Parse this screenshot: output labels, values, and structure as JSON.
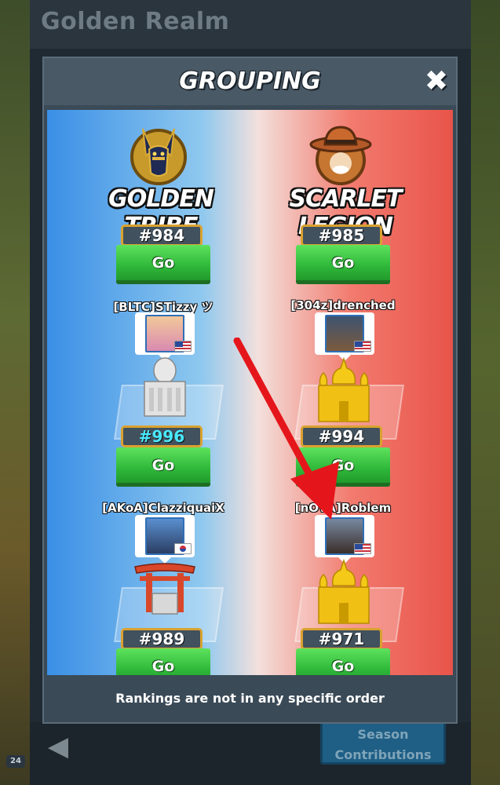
{
  "background": {
    "realm_title": "Golden Realm",
    "back_icon": "back-arrow-icon",
    "level_badge": "24",
    "season_button": {
      "line1": "Season",
      "line2": "Contributions"
    }
  },
  "modal": {
    "title": "GROUPING",
    "close_icon": "close-icon",
    "footer_note": "Rankings are not in any specific order"
  },
  "teams": [
    {
      "name": "GOLDEN TRIBE",
      "emblem": "anubis-emblem-icon",
      "color": "#3a8fe6"
    },
    {
      "name": "SCARLET LEGION",
      "emblem": "cowboy-emblem-icon",
      "color": "#e8544a"
    }
  ],
  "entries": [
    {
      "team": 0,
      "rank": "#984",
      "go_label": "Go",
      "player": ""
    },
    {
      "team": 1,
      "rank": "#985",
      "go_label": "Go",
      "player": ""
    },
    {
      "team": 0,
      "rank": "#996",
      "go_label": "Go",
      "player": "[BLTC]STizzy ツ",
      "flag": "us",
      "building": "white-temple",
      "highlight": true
    },
    {
      "team": 1,
      "rank": "#994",
      "go_label": "Go",
      "player": "[304z]drenched",
      "flag": "us",
      "building": "golden-palace"
    },
    {
      "team": 0,
      "rank": "#989",
      "go_label": "Go",
      "player": "[AKoA]ClazziquaiX",
      "flag": "kr",
      "building": "torii-gate"
    },
    {
      "team": 1,
      "rank": "#971",
      "go_label": "Go",
      "player": "[nOVA]Roblem",
      "flag": "us",
      "building": "golden-palace"
    }
  ],
  "colors": {
    "go_green": "#2fb83a",
    "plaque_gold": "#d9a230",
    "highlight_rank": "#49e9ff",
    "arrow_red": "#e5161b"
  }
}
